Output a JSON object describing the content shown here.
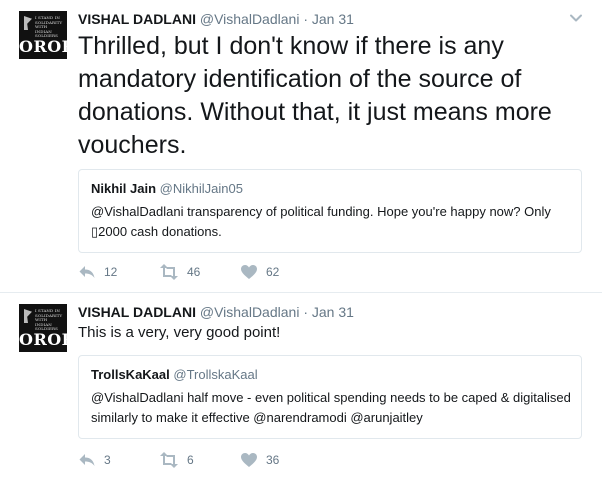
{
  "tweets": [
    {
      "avatar": {
        "small_text": "I stand in solidarity with Indian soldiers",
        "big_text": "OROP"
      },
      "name": "VISHAL DADLANI",
      "handle": "@VishalDadlani",
      "dot": "·",
      "date": "Jan 31",
      "text": "Thrilled, but I don't know if there is any mandatory identification of the source of donations. Without that, it just means more vouchers.",
      "quote": {
        "name": "Nikhil Jain",
        "handle": "@NikhilJain05",
        "text": "@VishalDadlani transparency of political funding. Hope you're happy now? Only ▯2000 cash donations."
      },
      "actions": {
        "replies": "12",
        "retweets": "46",
        "likes": "62"
      },
      "icons": {
        "menu": "chevron-down-icon",
        "reply": "reply-icon",
        "retweet": "retweet-icon",
        "like": "heart-icon"
      }
    },
    {
      "avatar": {
        "small_text": "I stand in solidarity with Indian soldiers",
        "big_text": "OROP"
      },
      "name": "VISHAL DADLANI",
      "handle": "@VishalDadlani",
      "dot": "·",
      "date": "Jan 31",
      "text": "This is a very, very good point!",
      "quote": {
        "name": "TrollsKaKaal",
        "handle": "@TrollskaKaal",
        "text": "@VishalDadlani half move - even political spending needs to be caped & digitalised similarly to make it effective @narendramodi @arunjaitley"
      },
      "actions": {
        "replies": "3",
        "retweets": "6",
        "likes": "36"
      },
      "icons": {
        "menu": "chevron-down-icon",
        "reply": "reply-icon",
        "retweet": "retweet-icon",
        "like": "heart-icon"
      }
    }
  ],
  "colors": {
    "text": "#14171a",
    "secondary": "#657786",
    "border": "#e6ecf0",
    "icon": "#aab8c2"
  }
}
